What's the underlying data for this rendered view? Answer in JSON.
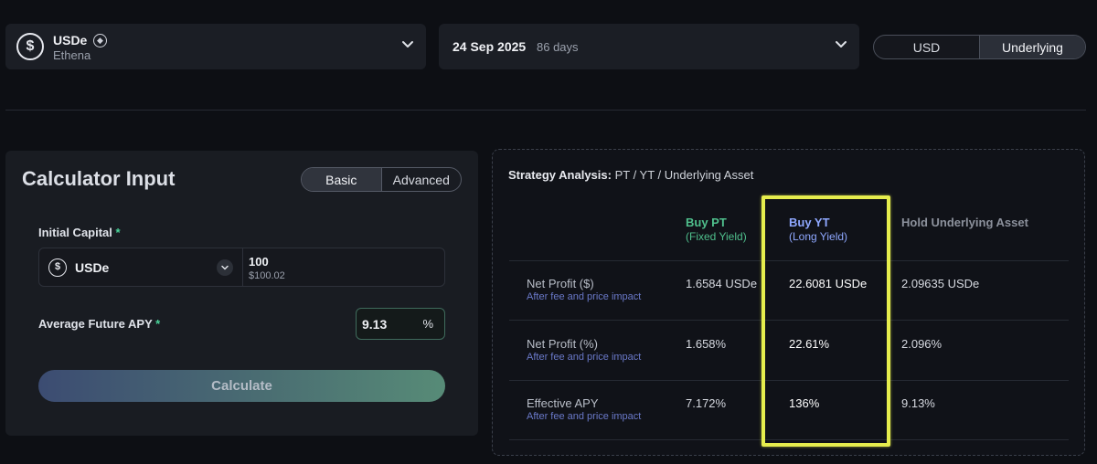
{
  "asset": {
    "name": "USDe",
    "protocol": "Ethena",
    "icon": "dollar-coin-icon",
    "chain_icon": "ethereum-icon"
  },
  "maturity": {
    "date": "24 Sep 2025",
    "days": "86 days"
  },
  "display_toggle": {
    "options": [
      "USD",
      "Underlying"
    ],
    "selected": "Underlying"
  },
  "calculator": {
    "title": "Calculator Input",
    "modes": [
      "Basic",
      "Advanced"
    ],
    "selected_mode": "Basic",
    "initial_capital": {
      "label": "Initial Capital",
      "required_mark": "*",
      "asset": "USDe",
      "value": "100",
      "usd_value": "$100.02"
    },
    "apy": {
      "label": "Average Future APY",
      "required_mark": "*",
      "value": "9.13",
      "unit": "%"
    },
    "button_label": "Calculate"
  },
  "strategy": {
    "title_bold": "Strategy Analysis:",
    "title_rest": "PT / YT / Underlying Asset",
    "columns": [
      {
        "title": "Buy PT",
        "subtitle": "(Fixed Yield)",
        "color": "#4fbf8c"
      },
      {
        "title": "Buy YT",
        "subtitle": "(Long Yield)",
        "color": "#8fa8ff"
      },
      {
        "title": "Hold Underlying Asset",
        "subtitle": "",
        "color": "#8c919c"
      }
    ],
    "rows": [
      {
        "label": "Net Profit ($)",
        "note": "After fee and price impact",
        "values": [
          "1.6584 USDe",
          "22.6081 USDe",
          "2.09635 USDe"
        ]
      },
      {
        "label": "Net Profit (%)",
        "note": "After fee and price impact",
        "values": [
          "1.658%",
          "22.61%",
          "2.096%"
        ]
      },
      {
        "label": "Effective APY",
        "note": "After fee and price impact",
        "values": [
          "7.172%",
          "136%",
          "9.13%"
        ]
      }
    ],
    "highlight_color": "#e6ed4d"
  }
}
